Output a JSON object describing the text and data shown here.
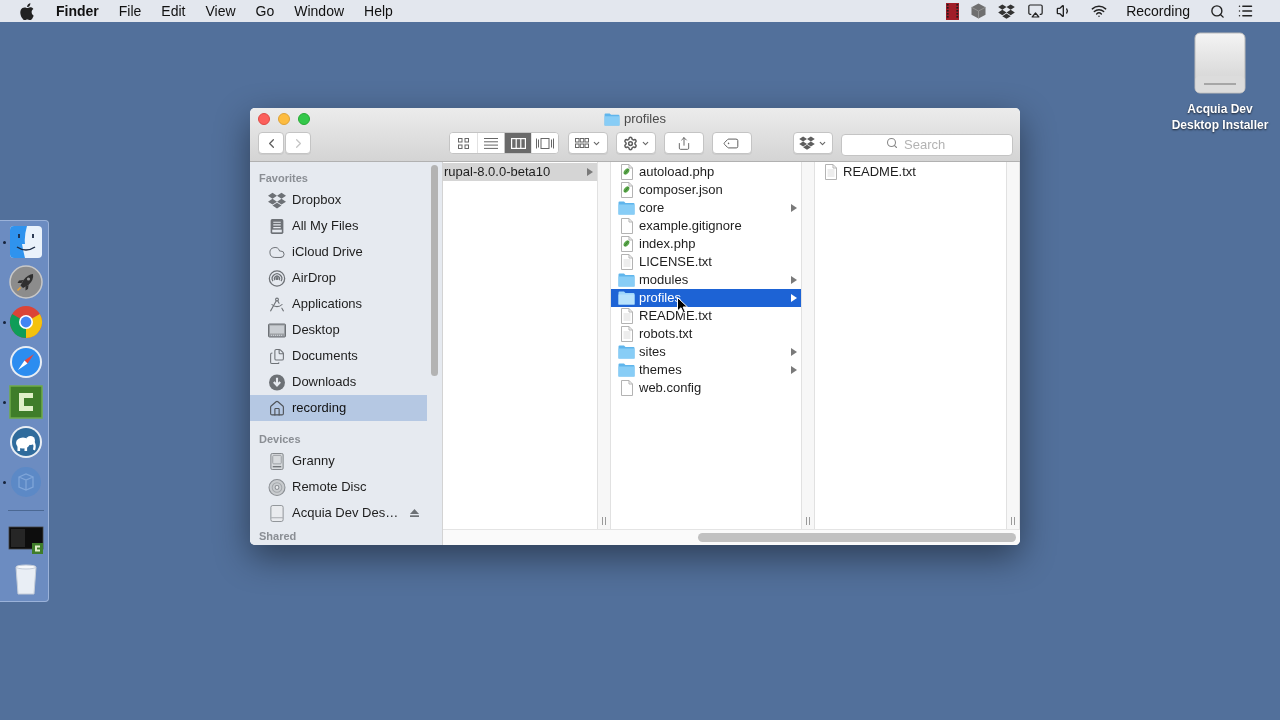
{
  "menu_bar": {
    "app_name": "Finder",
    "menus": [
      "File",
      "Edit",
      "View",
      "Go",
      "Window",
      "Help"
    ],
    "status_text": "Recording"
  },
  "desktop_icons": [
    {
      "label": "Acquia Dev Desktop Installer"
    }
  ],
  "dock": {
    "apps": [
      {
        "kind": "finder",
        "running": true
      },
      {
        "kind": "launchpad",
        "running": false
      },
      {
        "kind": "chrome",
        "running": true
      },
      {
        "kind": "safari",
        "running": false
      },
      {
        "kind": "camtasia",
        "running": true
      },
      {
        "kind": "elephant",
        "running": false
      },
      {
        "kind": "box",
        "running": true
      }
    ],
    "others": [
      {
        "kind": "screen"
      },
      {
        "kind": "trash"
      }
    ]
  },
  "window": {
    "title": "profiles",
    "back_disabled": false,
    "forward_disabled": true,
    "view_modes": [
      {
        "kind": "icon",
        "selected": false
      },
      {
        "kind": "list",
        "selected": false
      },
      {
        "kind": "column",
        "selected": true
      },
      {
        "kind": "coverflow",
        "selected": false
      }
    ],
    "search": {
      "placeholder": "Search"
    }
  },
  "sidebar": {
    "sections": [
      {
        "heading": "Favorites",
        "items": [
          {
            "label": "Dropbox",
            "kind": "dropbox",
            "selected": false
          },
          {
            "label": "All My Files",
            "kind": "files",
            "selected": false
          },
          {
            "label": "iCloud Drive",
            "kind": "icloud",
            "selected": false
          },
          {
            "label": "AirDrop",
            "kind": "airdrop",
            "selected": false
          },
          {
            "label": "Applications",
            "kind": "applications",
            "selected": false
          },
          {
            "label": "Desktop",
            "kind": "desktop",
            "selected": false
          },
          {
            "label": "Documents",
            "kind": "documents",
            "selected": false
          },
          {
            "label": "Downloads",
            "kind": "downloads",
            "selected": false
          },
          {
            "label": "recording",
            "kind": "home",
            "selected": true
          }
        ]
      },
      {
        "heading": "Devices",
        "items": [
          {
            "label": "Granny",
            "kind": "disk",
            "selected": false,
            "ejectable": false
          },
          {
            "label": "Remote Disc",
            "kind": "disc",
            "selected": false,
            "ejectable": false
          },
          {
            "label": "Acquia Dev Des…",
            "kind": "drive",
            "selected": false,
            "ejectable": true
          }
        ]
      },
      {
        "heading": "Shared"
      }
    ]
  },
  "columns": [
    {
      "items": [
        {
          "name": "rupal-8.0.0-beta10",
          "expandable": true,
          "selected": true
        }
      ]
    },
    {
      "items": [
        {
          "name": "autoload.php",
          "kind": "php",
          "expandable": false,
          "selected": false
        },
        {
          "name": "composer.json",
          "kind": "php",
          "expandable": false,
          "selected": false
        },
        {
          "name": "core",
          "kind": "folder",
          "expandable": true,
          "selected": false
        },
        {
          "name": "example.gitignore",
          "kind": "file",
          "expandable": false,
          "selected": false
        },
        {
          "name": "index.php",
          "kind": "php",
          "expandable": false,
          "selected": false
        },
        {
          "name": "LICENSE.txt",
          "kind": "text",
          "expandable": false,
          "selected": false
        },
        {
          "name": "modules",
          "kind": "folder",
          "expandable": true,
          "selected": false
        },
        {
          "name": "profiles",
          "kind": "folder",
          "expandable": true,
          "selected": true
        },
        {
          "name": "README.txt",
          "kind": "text",
          "expandable": false,
          "selected": false
        },
        {
          "name": "robots.txt",
          "kind": "text",
          "expandable": false,
          "selected": false
        },
        {
          "name": "sites",
          "kind": "folder",
          "expandable": true,
          "selected": false
        },
        {
          "name": "themes",
          "kind": "folder",
          "expandable": true,
          "selected": false
        },
        {
          "name": "web.config",
          "kind": "file",
          "expandable": false,
          "selected": false
        }
      ]
    },
    {
      "items": [
        {
          "name": "README.txt",
          "kind": "text",
          "expandable": false,
          "selected": false
        }
      ]
    }
  ]
}
